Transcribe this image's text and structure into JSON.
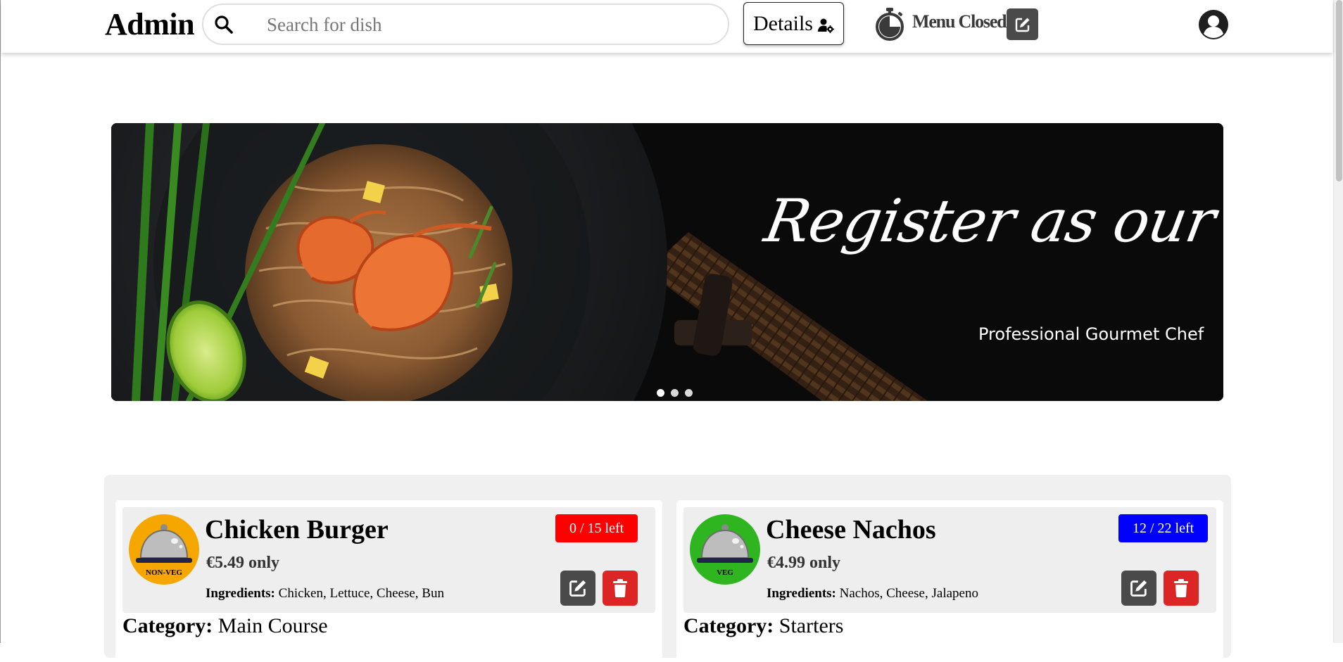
{
  "header": {
    "brand": "Admin",
    "search_placeholder": "Search for dish",
    "details_label": "Details",
    "menu_status": "Menu Closed"
  },
  "banner": {
    "title": "Register as our chef",
    "subtitle": "Professional Gourmet Chef",
    "slides": 3,
    "active_slide": 0
  },
  "dishes": [
    {
      "name": "Chicken Burger",
      "price": "€5.49 only",
      "ingredients_label": "Ingredients:",
      "ingredients": "Chicken, Lettuce, Cheese, Bun",
      "stock": "0 / 15 left",
      "stock_color": "#ff0000",
      "type_label": "NON-VEG",
      "type_color": "#f5a700",
      "category_label": "Category:",
      "category": "Main Course"
    },
    {
      "name": "Cheese Nachos",
      "price": "€4.99 only",
      "ingredients_label": "Ingredients:",
      "ingredients": "Nachos, Cheese, Jalapeno",
      "stock": "12 / 22 left",
      "stock_color": "#0000ff",
      "type_label": "VEG",
      "type_color": "#2fb51f",
      "category_label": "Category:",
      "category": "Starters"
    }
  ],
  "colors": {
    "edit_button": "#4a4a4a",
    "delete_button": "#dc2626"
  },
  "icons": {
    "search": "search-icon",
    "details": "user-gear-icon",
    "timer": "stopwatch-icon",
    "edit": "pen-to-square-icon",
    "delete": "trash-icon",
    "profile": "user-circle-icon",
    "dish": "cloche-icon"
  }
}
